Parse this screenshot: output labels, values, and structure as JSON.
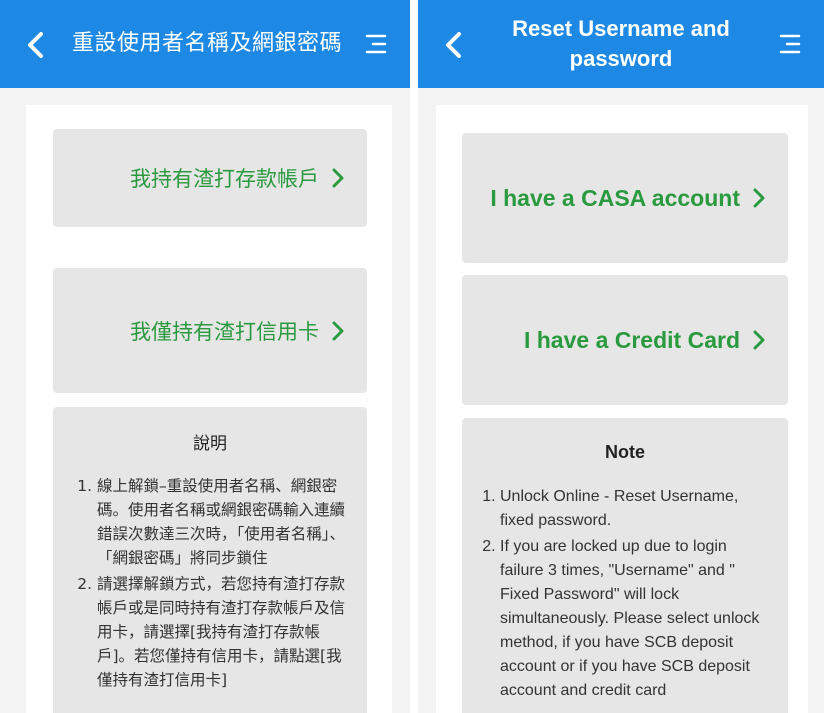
{
  "colors": {
    "header_bg": "#1e88e5",
    "accent_green": "#2a9a3e",
    "card_bg": "#e6e6e6",
    "page_bg": "#f3f3f3"
  },
  "panel_zh": {
    "back_icon": "chevron-left-icon",
    "menu_icon": "menu-icon",
    "title": "重設使用者名稱及網銀密碼",
    "options": [
      {
        "label": "我持有渣打存款帳戶"
      },
      {
        "label": "我僅持有渣打信用卡"
      }
    ],
    "note": {
      "title": "說明",
      "items": [
        "線上解鎖–重設使用者名稱、網銀密碼。使用者名稱或網銀密碼輸入連續錯誤次數達三次時，「使用者名稱」、「網銀密碼」將同步鎖住",
        "請選擇解鎖方式，若您持有渣打存款帳戶或是同時持有渣打存款帳戶及信用卡，請選擇[我持有渣打存款帳戶]。若您僅持有信用卡，請點選[我僅持有渣打信用卡]"
      ]
    }
  },
  "panel_en": {
    "back_icon": "chevron-left-icon",
    "menu_icon": "menu-icon",
    "title": "Reset Username and password",
    "options": [
      {
        "label": "I have a CASA account"
      },
      {
        "label": "I have a Credit Card"
      }
    ],
    "note": {
      "title": "Note",
      "items": [
        "Unlock Online - Reset Username, fixed password.",
        "If you are locked up due to login failure 3 times, \"Username\" and \" Fixed Password\" will lock simultaneously. Please select unlock method, if you have SCB deposit account or if you have SCB deposit account and credit card"
      ]
    }
  }
}
